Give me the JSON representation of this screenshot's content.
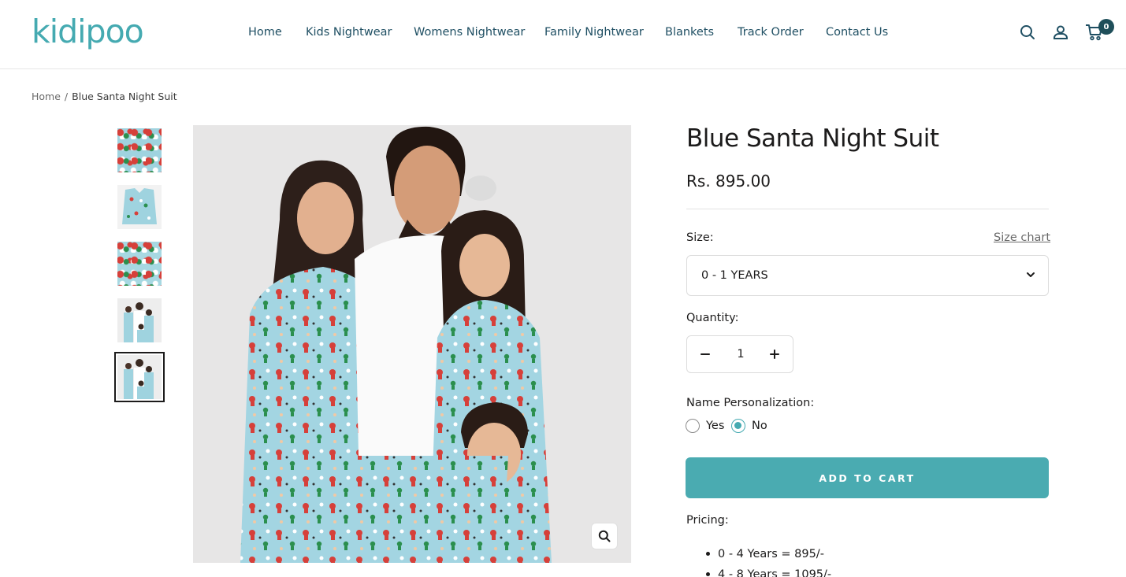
{
  "brand": {
    "logo_text": "kidipoo",
    "accent_color": "#45aab1"
  },
  "nav": {
    "items": [
      {
        "label": "Home"
      },
      {
        "label": "Kids Nightwear"
      },
      {
        "label": "Womens Nightwear"
      },
      {
        "label": "Family Nightwear"
      },
      {
        "label": "Blankets"
      },
      {
        "label": "Track Order"
      },
      {
        "label": "Contact Us"
      }
    ],
    "icons": [
      "search-icon",
      "account-icon",
      "cart-icon"
    ],
    "cart_count": "0"
  },
  "breadcrumb": {
    "home": "Home",
    "separator": "/",
    "current": "Blue Santa Night Suit"
  },
  "gallery": {
    "thumbnails": [
      {
        "kind": "product-flat-lay"
      },
      {
        "kind": "product-shirt"
      },
      {
        "kind": "product-folded"
      },
      {
        "kind": "family-photo"
      },
      {
        "kind": "family-photo",
        "selected": true
      }
    ],
    "zoom_icon": "zoom-icon"
  },
  "product": {
    "title": "Blue Santa Night Suit",
    "price": "Rs. 895.00",
    "size_label": "Size:",
    "size_chart_link": "Size chart",
    "size_selected": "0 - 1 YEARS",
    "quantity_label": "Quantity:",
    "quantity": "1",
    "personalization_label": "Name Personalization:",
    "personalization_options": [
      {
        "label": "Yes",
        "checked": false
      },
      {
        "label": "No",
        "checked": true
      }
    ],
    "add_to_cart": "ADD TO CART",
    "button_color": "#4aabb1",
    "pricing_label": "Pricing:",
    "pricing_list": [
      "0 - 4 Years = 895/-",
      "4 - 8 Years = 1095/-"
    ]
  }
}
